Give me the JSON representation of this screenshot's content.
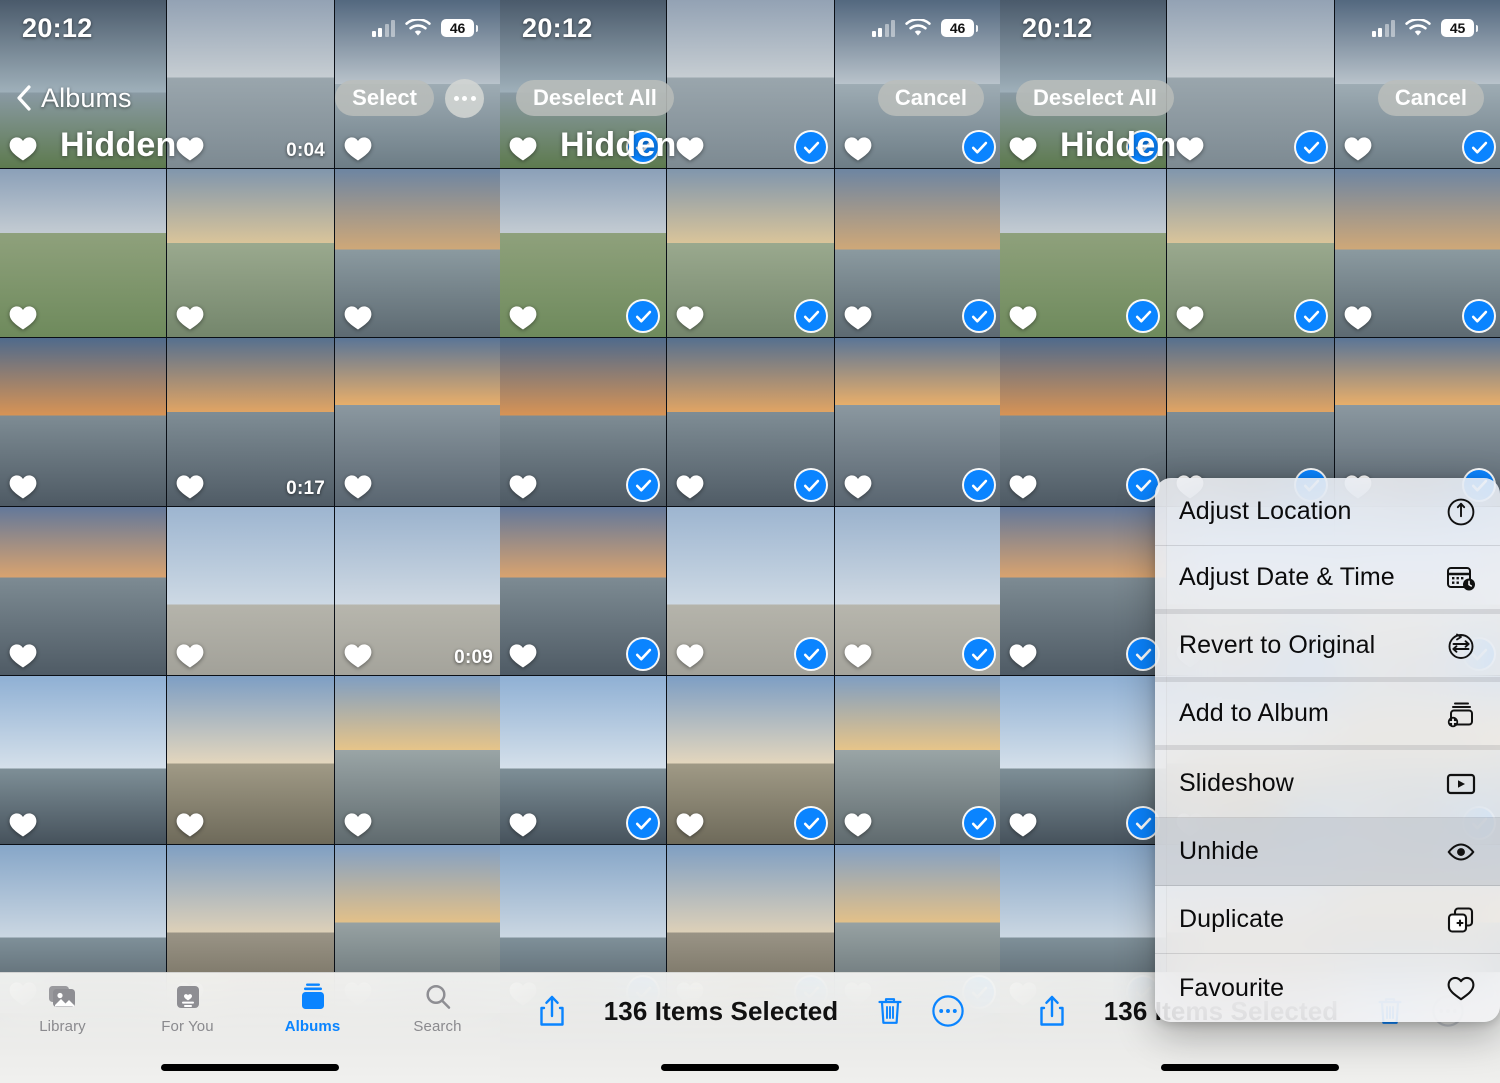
{
  "panels": [
    {
      "id": "browse",
      "status": {
        "time": "20:12",
        "battery": "46"
      },
      "nav": {
        "back_label": "Albums",
        "select_label": "Select",
        "more_label": "more-options"
      },
      "album_title": "Hidden",
      "tabbar": {
        "items": [
          {
            "label": "Library",
            "icon": "photos-stack-icon",
            "active": false
          },
          {
            "label": "For You",
            "icon": "for-you-card-icon",
            "active": false
          },
          {
            "label": "Albums",
            "icon": "albums-icon",
            "active": true
          },
          {
            "label": "Search",
            "icon": "search-icon",
            "active": false
          }
        ]
      },
      "durations": {
        "r1c2": "0:04",
        "r3c2": "0:17",
        "r4c3": "0:09"
      }
    },
    {
      "id": "selected",
      "status": {
        "time": "20:12",
        "battery": "46"
      },
      "nav": {
        "deselect_label": "Deselect All",
        "cancel_label": "Cancel"
      },
      "album_title": "Hidden",
      "toolbar": {
        "count_label": "136 Items Selected",
        "share_icon": "share-icon",
        "trash_icon": "trash-icon",
        "more_icon": "more-circle-icon"
      }
    },
    {
      "id": "menu-open",
      "status": {
        "time": "20:12",
        "battery": "45"
      },
      "nav": {
        "deselect_label": "Deselect All",
        "cancel_label": "Cancel"
      },
      "album_title": "Hidden",
      "toolbar": {
        "count_label": "136 Items Selected",
        "share_icon": "share-icon",
        "trash_icon": "trash-icon",
        "more_icon": "more-circle-icon",
        "more_disabled": true
      },
      "context_menu": {
        "items": [
          {
            "label": "Adjust Location",
            "icon": "location-pin-circle-icon",
            "highlighted": false,
            "group_end": false
          },
          {
            "label": "Adjust Date & Time",
            "icon": "calendar-clock-icon",
            "highlighted": false,
            "group_end": true
          },
          {
            "label": "Revert to Original",
            "icon": "revert-circle-icon",
            "highlighted": false,
            "group_end": true
          },
          {
            "label": "Add to Album",
            "icon": "add-to-album-icon",
            "highlighted": false,
            "group_end": true
          },
          {
            "label": "Slideshow",
            "icon": "slideshow-play-icon",
            "highlighted": false,
            "group_end": false
          },
          {
            "label": "Unhide",
            "icon": "eye-icon",
            "highlighted": true,
            "group_end": false
          },
          {
            "label": "Duplicate",
            "icon": "duplicate-icon",
            "highlighted": false,
            "group_end": false
          },
          {
            "label": "Favourite",
            "icon": "heart-outline-icon",
            "highlighted": false,
            "group_end": false
          }
        ]
      }
    }
  ],
  "colors": {
    "accent_blue": "#0a84ff",
    "check_blue": "#0a84ff",
    "tab_inactive": "#8a8a8e",
    "menu_bg": "#f3f3f5"
  }
}
